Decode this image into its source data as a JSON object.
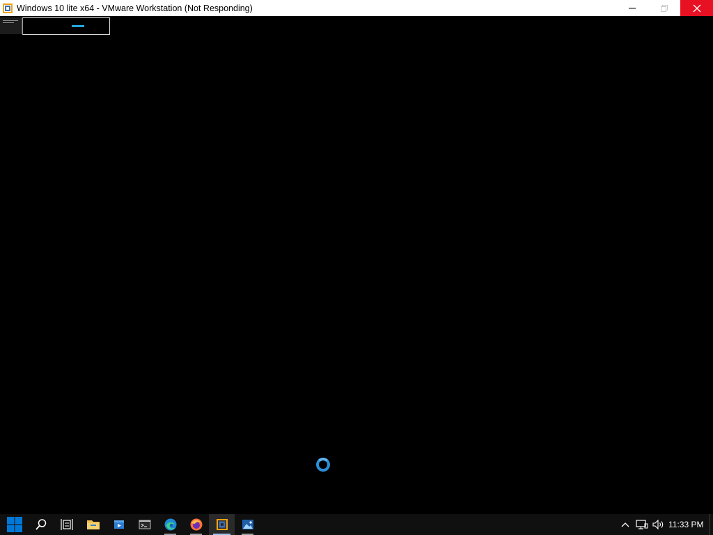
{
  "window": {
    "title": "Windows 10 lite x64 - VMware Workstation (Not Responding)",
    "app_icon": "vmware-icon",
    "controls": [
      "minimize-icon",
      "maximize-icon",
      "close-icon"
    ]
  },
  "console": {
    "state": "loading",
    "spinner_color": "#2b8ed8",
    "thumbnail_accent": "#23a7dc"
  },
  "taskbar": {
    "items": [
      {
        "name": "start-button",
        "icon": "windows-logo-icon"
      },
      {
        "name": "search-button",
        "icon": "search-icon"
      },
      {
        "name": "task-view-button",
        "icon": "task-view-icon"
      },
      {
        "name": "file-explorer-button",
        "icon": "folder-icon"
      },
      {
        "name": "media-app-button",
        "icon": "media-icon"
      },
      {
        "name": "terminal-button",
        "icon": "terminal-icon"
      },
      {
        "name": "edge-button",
        "icon": "edge-icon"
      },
      {
        "name": "firefox-button",
        "icon": "firefox-icon"
      },
      {
        "name": "vmware-button",
        "icon": "vmware-icon"
      },
      {
        "name": "photos-button",
        "icon": "photos-icon"
      }
    ],
    "tray": {
      "icons": [
        "chevron-up-icon",
        "network-icon",
        "volume-icon"
      ],
      "clock": "11:33 PM"
    }
  },
  "colors": {
    "close_button": "#e81123",
    "taskbar_bg": "#101010",
    "windows_blue": "#0078d7"
  }
}
